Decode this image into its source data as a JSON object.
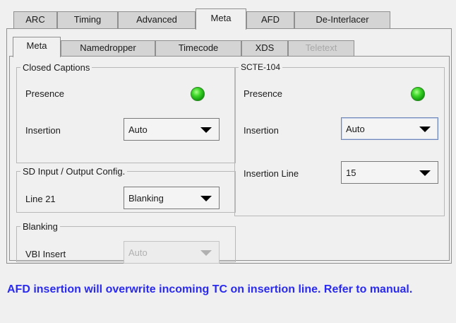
{
  "top_tabs": [
    {
      "label": "ARC",
      "active": false
    },
    {
      "label": "Timing",
      "active": false
    },
    {
      "label": "Advanced",
      "active": false
    },
    {
      "label": "Meta",
      "active": true
    },
    {
      "label": "AFD",
      "active": false
    },
    {
      "label": "De-Interlacer",
      "active": false
    }
  ],
  "sub_tabs": [
    {
      "label": "Meta",
      "active": true,
      "disabled": false
    },
    {
      "label": "Namedropper",
      "active": false,
      "disabled": false
    },
    {
      "label": "Timecode",
      "active": false,
      "disabled": false
    },
    {
      "label": "XDS",
      "active": false,
      "disabled": false
    },
    {
      "label": "Teletext",
      "active": false,
      "disabled": true
    }
  ],
  "closed_captions": {
    "title": "Closed Captions",
    "presence_label": "Presence",
    "presence_status_color": "#2fc021",
    "insertion_label": "Insertion",
    "insertion_value": "Auto"
  },
  "sd_config": {
    "title": "SD Input / Output Config.",
    "line21_label": "Line 21",
    "line21_value": "Blanking"
  },
  "blanking": {
    "title": "Blanking",
    "vbi_label": "VBI Insert",
    "vbi_value": "Auto"
  },
  "scte104": {
    "title": "SCTE-104",
    "presence_label": "Presence",
    "presence_status_color": "#2fc021",
    "insertion_label": "Insertion",
    "insertion_value": "Auto",
    "insertion_line_label": "Insertion Line",
    "insertion_line_value": "15"
  },
  "status_message": "AFD insertion will overwrite incoming TC on insertion line. Refer to manual.",
  "colors": {
    "status_text": "#2a2af0",
    "panel_bg": "#f0f0f0",
    "tab_bg": "#d4d4d4"
  }
}
